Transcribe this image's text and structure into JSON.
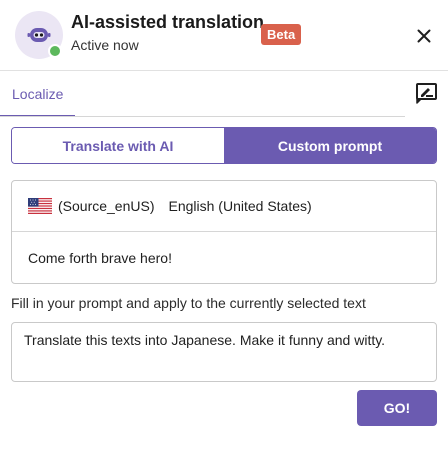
{
  "header": {
    "title": "AI-assisted translation",
    "badge": "Beta",
    "status": "Active now",
    "status_color": "#5cb85c",
    "badge_color": "#d9614c",
    "avatar_icon": "robot-icon",
    "close_icon": "close-icon"
  },
  "tabs": {
    "items": [
      {
        "label": "Localize",
        "active": true
      }
    ],
    "action_icon": "edit-note-icon"
  },
  "mode_toggle": {
    "options": [
      {
        "label": "Translate with AI",
        "selected": false
      },
      {
        "label": "Custom prompt",
        "selected": true
      }
    ],
    "accent_color": "#6b5bb1"
  },
  "source": {
    "flag_icon": "us-flag-icon",
    "locale_code": "(Source_enUS)",
    "language_name": "English (United States)",
    "text": "Come forth brave hero!"
  },
  "prompt": {
    "instruction": "Fill in your prompt and apply to the currently selected text",
    "value": "Translate this texts into Japanese. Make it funny and witty."
  },
  "actions": {
    "go_label": "GO!"
  }
}
